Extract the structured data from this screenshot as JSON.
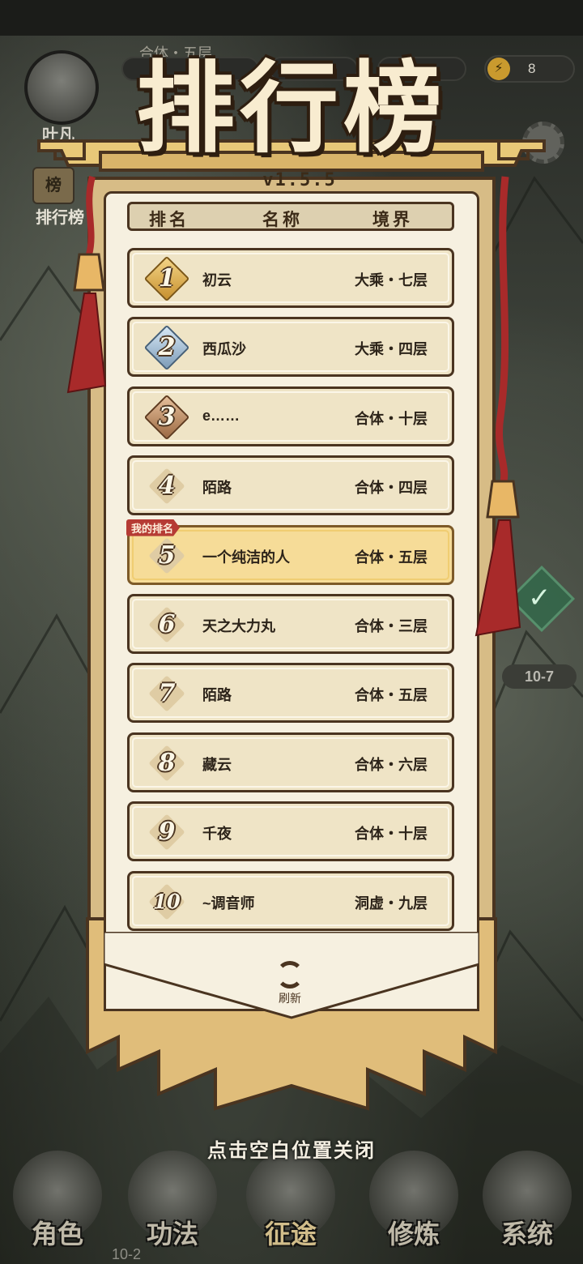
{
  "hud": {
    "player_name": "叶凡",
    "realm": "合体・五层",
    "energy": "8",
    "side_rank_icon_text": "榜",
    "side_rank_label": "排行榜"
  },
  "map": {
    "stage_label": "10-7",
    "stage_label_bottom": "10-2"
  },
  "leaderboard": {
    "title": "排行榜",
    "version": "v1.5.5",
    "headers": {
      "rank": "排名",
      "name": "名称",
      "realm": "境界"
    },
    "my_rank_tag": "我的排名",
    "rows": [
      {
        "rank": "1",
        "name": "初云",
        "realm": "大乘・七层"
      },
      {
        "rank": "2",
        "name": "西瓜沙",
        "realm": "大乘・四层"
      },
      {
        "rank": "3",
        "name": "e……",
        "realm": "合体・十层"
      },
      {
        "rank": "4",
        "name": "陌路",
        "realm": "合体・四层"
      },
      {
        "rank": "5",
        "name": "一个纯洁的人",
        "realm": "合体・五层"
      },
      {
        "rank": "6",
        "name": "天之大力丸",
        "realm": "合体・三层"
      },
      {
        "rank": "7",
        "name": "陌路",
        "realm": "合体・五层"
      },
      {
        "rank": "8",
        "name": "藏云",
        "realm": "合体・六层"
      },
      {
        "rank": "9",
        "name": "千夜",
        "realm": "合体・十层"
      },
      {
        "rank": "10",
        "name": "~调音师",
        "realm": "洞虚・九层"
      }
    ],
    "refresh_label": "刷新",
    "close_hint": "点击空白位置关闭"
  },
  "nav": {
    "items": [
      {
        "label": "角色"
      },
      {
        "label": "功法"
      },
      {
        "label": "征途"
      },
      {
        "label": "修炼"
      },
      {
        "label": "系统"
      }
    ]
  },
  "colors": {
    "panel_bg": "#f6f0e0",
    "row_bg": "#efe4c6",
    "my_row_bg": "#f6dc98",
    "ink": "#4a3420",
    "tassel_red": "#a82a2a",
    "tag_red": "#b63b34"
  }
}
